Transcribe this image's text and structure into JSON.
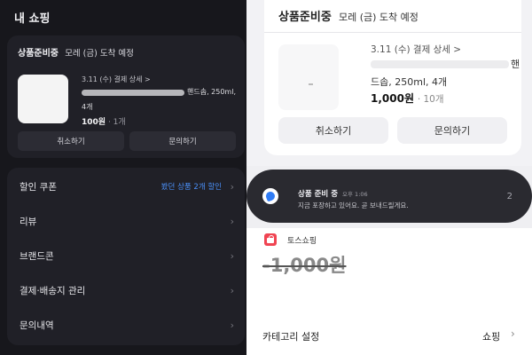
{
  "left": {
    "title": "내 쇼핑",
    "order": {
      "status": "상품준비중",
      "arrival": "모레 (금) 도착 예정",
      "detail_link": "3.11 (수) 결제 상세 >",
      "product_name_tail": "핸드솝, 250ml,",
      "product_name_line2": "4개",
      "price": "100원",
      "quantity": "· 1개",
      "cancel_label": "취소하기",
      "inquiry_label": "문의하기"
    },
    "menu": [
      {
        "label": "할인 쿠폰",
        "extra": "봤던 상품 2개 할인"
      },
      {
        "label": "리뷰",
        "extra": ""
      },
      {
        "label": "브랜드콘",
        "extra": ""
      },
      {
        "label": "결제·배송지 관리",
        "extra": ""
      },
      {
        "label": "문의내역",
        "extra": ""
      }
    ],
    "colors": {
      "background": "#17171c",
      "card": "#202027",
      "accent": "#4a8ff7"
    }
  },
  "right_top": {
    "status": "상품준비중",
    "arrival": "모레 (금) 도착 예정",
    "detail_link": "3.11 (수) 결제 상세 >",
    "product_name_tail": "핸",
    "product_name_line2": "드솝, 250ml, 4개",
    "price": "1,000원",
    "quantity": "· 10개",
    "cancel_label": "취소하기",
    "inquiry_label": "문의하기"
  },
  "notification": {
    "title": "상품 준비 중",
    "time": "오후 1:06",
    "body": "지금 포장하고 있어요. 곧 보내드릴게요.",
    "count": "2",
    "icon": "toss-app-icon"
  },
  "right_bottom": {
    "shop_name": "토스쇼핑",
    "amount": "-1,000원",
    "category_label": "카테고리 설정",
    "category_value": "쇼핑",
    "colors": {
      "shop_icon": "#f04452"
    }
  }
}
